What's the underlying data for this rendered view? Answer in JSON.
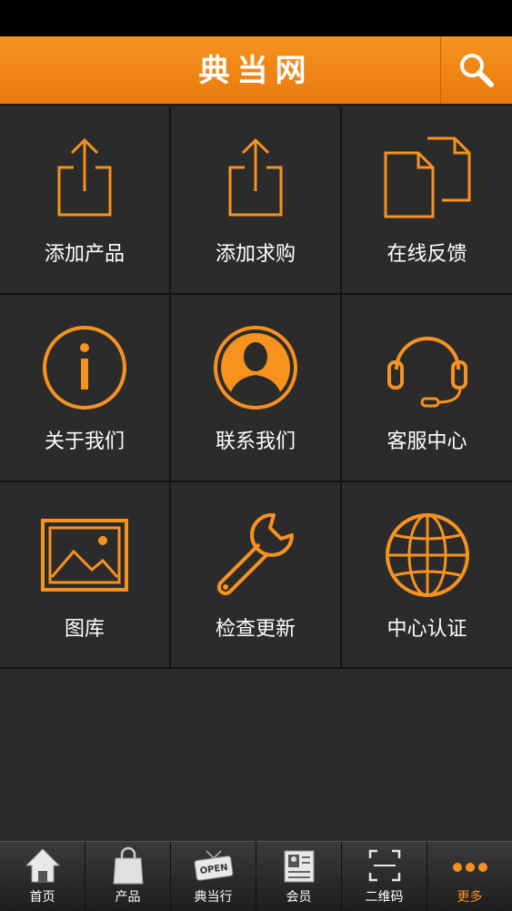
{
  "header": {
    "title": "典当网"
  },
  "grid": {
    "items": [
      {
        "label": "添加产品",
        "icon": "share-upload-icon"
      },
      {
        "label": "添加求购",
        "icon": "share-upload-icon"
      },
      {
        "label": "在线反馈",
        "icon": "copy-documents-icon"
      },
      {
        "label": "关于我们",
        "icon": "info-icon"
      },
      {
        "label": "联系我们",
        "icon": "contact-person-icon"
      },
      {
        "label": "客服中心",
        "icon": "headset-icon"
      },
      {
        "label": "图库",
        "icon": "image-gallery-icon"
      },
      {
        "label": "检查更新",
        "icon": "wrench-icon"
      },
      {
        "label": "中心认证",
        "icon": "globe-icon"
      }
    ]
  },
  "tabbar": {
    "items": [
      {
        "label": "首页",
        "icon": "home-icon"
      },
      {
        "label": "产品",
        "icon": "shopping-bag-icon"
      },
      {
        "label": "典当行",
        "icon": "open-sign-icon",
        "sign_text": "OPEN"
      },
      {
        "label": "会员",
        "icon": "member-card-icon"
      },
      {
        "label": "二维码",
        "icon": "qr-scan-icon"
      },
      {
        "label": "更多",
        "icon": "more-dots-icon",
        "active": true
      }
    ]
  },
  "colors": {
    "accent": "#f7921f",
    "background": "#2b2b2b",
    "divider": "#141414"
  }
}
